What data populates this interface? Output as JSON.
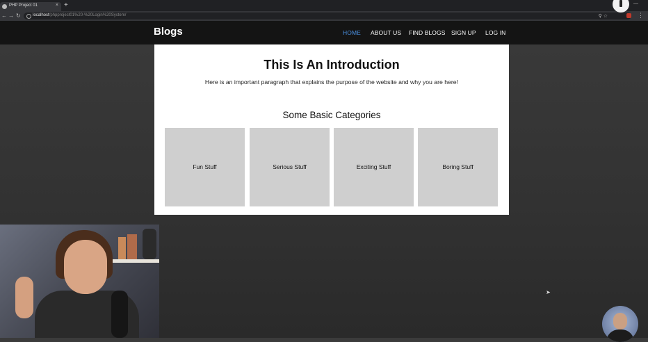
{
  "browser": {
    "tab_title": "PHP Project 01",
    "tab_close": "×",
    "new_tab": "+",
    "minimize": "—",
    "back": "←",
    "forward": "→",
    "reload": "↻",
    "url_host": "localhost",
    "url_path": "/phpproject01%20-%20Login%20System/",
    "addr_icons": "⚲ ☆",
    "menu": "⋮"
  },
  "site": {
    "brand": "Blogs",
    "nav": [
      "HOME",
      "ABOUT US",
      "FIND BLOGS",
      "SIGN UP",
      "LOG IN"
    ],
    "active_nav": "HOME",
    "accent_color": "#4a90e2"
  },
  "content": {
    "title": "This Is An Introduction",
    "intro": "Here is an important paragraph that explains the purpose of the website and why you are here!",
    "section_title": "Some Basic Categories",
    "categories": [
      "Fun Stuff",
      "Serious Stuff",
      "Exciting Stuff",
      "Boring Stuff"
    ]
  }
}
